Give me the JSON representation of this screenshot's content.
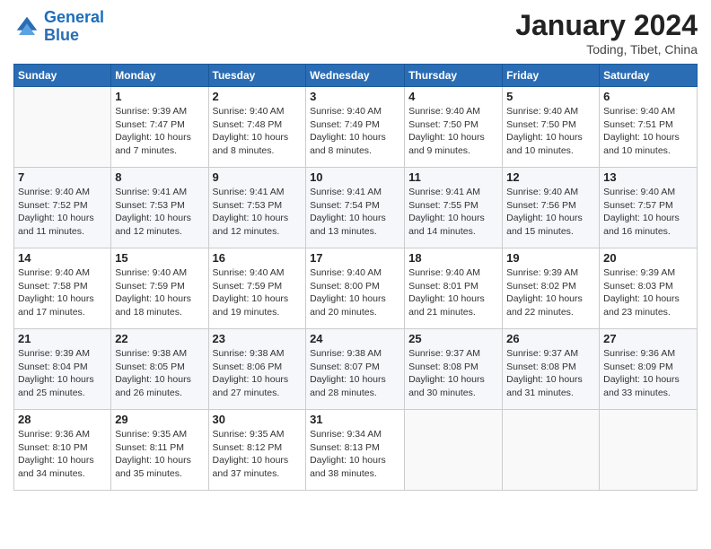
{
  "logo": {
    "line1": "General",
    "line2": "Blue"
  },
  "title": "January 2024",
  "location": "Toding, Tibet, China",
  "days_header": [
    "Sunday",
    "Monday",
    "Tuesday",
    "Wednesday",
    "Thursday",
    "Friday",
    "Saturday"
  ],
  "weeks": [
    [
      {
        "num": "",
        "sunrise": "",
        "sunset": "",
        "daylight": ""
      },
      {
        "num": "1",
        "sunrise": "Sunrise: 9:39 AM",
        "sunset": "Sunset: 7:47 PM",
        "daylight": "Daylight: 10 hours and 7 minutes."
      },
      {
        "num": "2",
        "sunrise": "Sunrise: 9:40 AM",
        "sunset": "Sunset: 7:48 PM",
        "daylight": "Daylight: 10 hours and 8 minutes."
      },
      {
        "num": "3",
        "sunrise": "Sunrise: 9:40 AM",
        "sunset": "Sunset: 7:49 PM",
        "daylight": "Daylight: 10 hours and 8 minutes."
      },
      {
        "num": "4",
        "sunrise": "Sunrise: 9:40 AM",
        "sunset": "Sunset: 7:50 PM",
        "daylight": "Daylight: 10 hours and 9 minutes."
      },
      {
        "num": "5",
        "sunrise": "Sunrise: 9:40 AM",
        "sunset": "Sunset: 7:50 PM",
        "daylight": "Daylight: 10 hours and 10 minutes."
      },
      {
        "num": "6",
        "sunrise": "Sunrise: 9:40 AM",
        "sunset": "Sunset: 7:51 PM",
        "daylight": "Daylight: 10 hours and 10 minutes."
      }
    ],
    [
      {
        "num": "7",
        "sunrise": "Sunrise: 9:40 AM",
        "sunset": "Sunset: 7:52 PM",
        "daylight": "Daylight: 10 hours and 11 minutes."
      },
      {
        "num": "8",
        "sunrise": "Sunrise: 9:41 AM",
        "sunset": "Sunset: 7:53 PM",
        "daylight": "Daylight: 10 hours and 12 minutes."
      },
      {
        "num": "9",
        "sunrise": "Sunrise: 9:41 AM",
        "sunset": "Sunset: 7:53 PM",
        "daylight": "Daylight: 10 hours and 12 minutes."
      },
      {
        "num": "10",
        "sunrise": "Sunrise: 9:41 AM",
        "sunset": "Sunset: 7:54 PM",
        "daylight": "Daylight: 10 hours and 13 minutes."
      },
      {
        "num": "11",
        "sunrise": "Sunrise: 9:41 AM",
        "sunset": "Sunset: 7:55 PM",
        "daylight": "Daylight: 10 hours and 14 minutes."
      },
      {
        "num": "12",
        "sunrise": "Sunrise: 9:40 AM",
        "sunset": "Sunset: 7:56 PM",
        "daylight": "Daylight: 10 hours and 15 minutes."
      },
      {
        "num": "13",
        "sunrise": "Sunrise: 9:40 AM",
        "sunset": "Sunset: 7:57 PM",
        "daylight": "Daylight: 10 hours and 16 minutes."
      }
    ],
    [
      {
        "num": "14",
        "sunrise": "Sunrise: 9:40 AM",
        "sunset": "Sunset: 7:58 PM",
        "daylight": "Daylight: 10 hours and 17 minutes."
      },
      {
        "num": "15",
        "sunrise": "Sunrise: 9:40 AM",
        "sunset": "Sunset: 7:59 PM",
        "daylight": "Daylight: 10 hours and 18 minutes."
      },
      {
        "num": "16",
        "sunrise": "Sunrise: 9:40 AM",
        "sunset": "Sunset: 7:59 PM",
        "daylight": "Daylight: 10 hours and 19 minutes."
      },
      {
        "num": "17",
        "sunrise": "Sunrise: 9:40 AM",
        "sunset": "Sunset: 8:00 PM",
        "daylight": "Daylight: 10 hours and 20 minutes."
      },
      {
        "num": "18",
        "sunrise": "Sunrise: 9:40 AM",
        "sunset": "Sunset: 8:01 PM",
        "daylight": "Daylight: 10 hours and 21 minutes."
      },
      {
        "num": "19",
        "sunrise": "Sunrise: 9:39 AM",
        "sunset": "Sunset: 8:02 PM",
        "daylight": "Daylight: 10 hours and 22 minutes."
      },
      {
        "num": "20",
        "sunrise": "Sunrise: 9:39 AM",
        "sunset": "Sunset: 8:03 PM",
        "daylight": "Daylight: 10 hours and 23 minutes."
      }
    ],
    [
      {
        "num": "21",
        "sunrise": "Sunrise: 9:39 AM",
        "sunset": "Sunset: 8:04 PM",
        "daylight": "Daylight: 10 hours and 25 minutes."
      },
      {
        "num": "22",
        "sunrise": "Sunrise: 9:38 AM",
        "sunset": "Sunset: 8:05 PM",
        "daylight": "Daylight: 10 hours and 26 minutes."
      },
      {
        "num": "23",
        "sunrise": "Sunrise: 9:38 AM",
        "sunset": "Sunset: 8:06 PM",
        "daylight": "Daylight: 10 hours and 27 minutes."
      },
      {
        "num": "24",
        "sunrise": "Sunrise: 9:38 AM",
        "sunset": "Sunset: 8:07 PM",
        "daylight": "Daylight: 10 hours and 28 minutes."
      },
      {
        "num": "25",
        "sunrise": "Sunrise: 9:37 AM",
        "sunset": "Sunset: 8:08 PM",
        "daylight": "Daylight: 10 hours and 30 minutes."
      },
      {
        "num": "26",
        "sunrise": "Sunrise: 9:37 AM",
        "sunset": "Sunset: 8:08 PM",
        "daylight": "Daylight: 10 hours and 31 minutes."
      },
      {
        "num": "27",
        "sunrise": "Sunrise: 9:36 AM",
        "sunset": "Sunset: 8:09 PM",
        "daylight": "Daylight: 10 hours and 33 minutes."
      }
    ],
    [
      {
        "num": "28",
        "sunrise": "Sunrise: 9:36 AM",
        "sunset": "Sunset: 8:10 PM",
        "daylight": "Daylight: 10 hours and 34 minutes."
      },
      {
        "num": "29",
        "sunrise": "Sunrise: 9:35 AM",
        "sunset": "Sunset: 8:11 PM",
        "daylight": "Daylight: 10 hours and 35 minutes."
      },
      {
        "num": "30",
        "sunrise": "Sunrise: 9:35 AM",
        "sunset": "Sunset: 8:12 PM",
        "daylight": "Daylight: 10 hours and 37 minutes."
      },
      {
        "num": "31",
        "sunrise": "Sunrise: 9:34 AM",
        "sunset": "Sunset: 8:13 PM",
        "daylight": "Daylight: 10 hours and 38 minutes."
      },
      {
        "num": "",
        "sunrise": "",
        "sunset": "",
        "daylight": ""
      },
      {
        "num": "",
        "sunrise": "",
        "sunset": "",
        "daylight": ""
      },
      {
        "num": "",
        "sunrise": "",
        "sunset": "",
        "daylight": ""
      }
    ]
  ]
}
